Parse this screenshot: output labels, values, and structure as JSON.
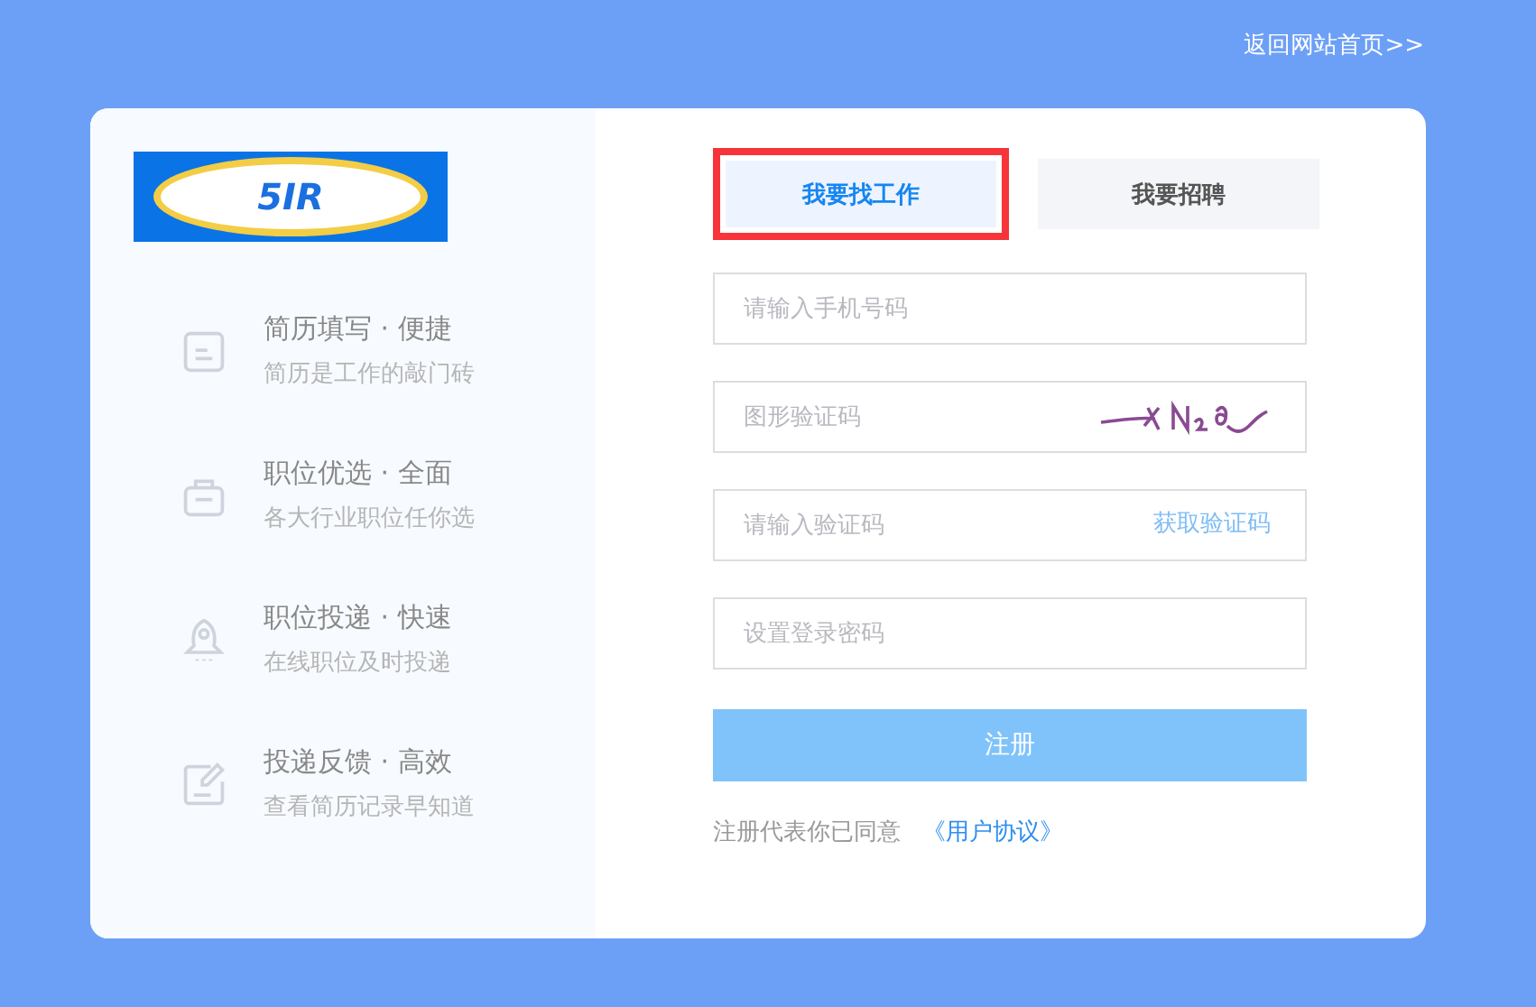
{
  "top_link": "返回网站首页>>",
  "logo": {
    "text": "5IR"
  },
  "features": [
    {
      "kind": "resume",
      "title": "简历填写 · 便捷",
      "subtitle": "简历是工作的敲门砖"
    },
    {
      "kind": "briefcase",
      "title": "职位优选 · 全面",
      "subtitle": "各大行业职位任你选"
    },
    {
      "kind": "rocket",
      "title": "职位投递 · 快速",
      "subtitle": "在线职位及时投递"
    },
    {
      "kind": "edit",
      "title": "投递反馈 · 高效",
      "subtitle": "查看简历记录早知道"
    }
  ],
  "tabs": [
    {
      "label": "我要找工作",
      "selected": true,
      "highlighted": true
    },
    {
      "label": "我要招聘",
      "selected": false,
      "highlighted": false
    }
  ],
  "fields": [
    {
      "kind": "plain",
      "placeholder": "请输入手机号码"
    },
    {
      "kind": "captcha",
      "placeholder": "图形验证码"
    },
    {
      "kind": "sms",
      "placeholder": "请输入验证码",
      "action": "获取验证码"
    },
    {
      "kind": "plain",
      "placeholder": "设置登录密码"
    }
  ],
  "submit": "注册",
  "agreement": {
    "text": "注册代表你已同意",
    "link": "《用户协议》"
  }
}
